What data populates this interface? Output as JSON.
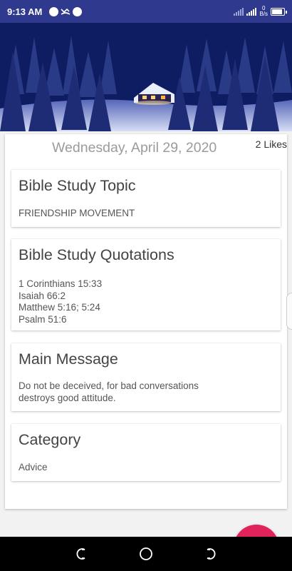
{
  "status_bar": {
    "time": "9:13 AM",
    "net_speed_value": "0",
    "net_speed_unit": "B/s",
    "icons": [
      "navigation-icon",
      "missed-call-icon",
      "phone-icon"
    ]
  },
  "post": {
    "date": "Wednesday, April 29, 2020",
    "likes": "2 Likes",
    "sections": [
      {
        "title": "Bible Study Topic",
        "lines": [
          "FRIENDSHIP MOVEMENT"
        ]
      },
      {
        "title": "Bible Study Quotations",
        "lines": [
          "1 Corinthians 15:33",
          "Isaiah 66:2",
          "Matthew 5:16; 5:24",
          "Psalm 51:6"
        ]
      },
      {
        "title": "Main Message",
        "lines": [
          "Do not be deceived, for bad conversations",
          "destroys good attitude."
        ]
      },
      {
        "title": "Category",
        "lines": [
          "Advice"
        ]
      }
    ]
  },
  "colors": {
    "status_bar": "#2f3a8f",
    "fab": "#e0245a",
    "date_text": "#9b9b9b"
  },
  "nav_bar": {
    "buttons": [
      "recent-apps-icon",
      "home-icon",
      "back-icon"
    ]
  }
}
